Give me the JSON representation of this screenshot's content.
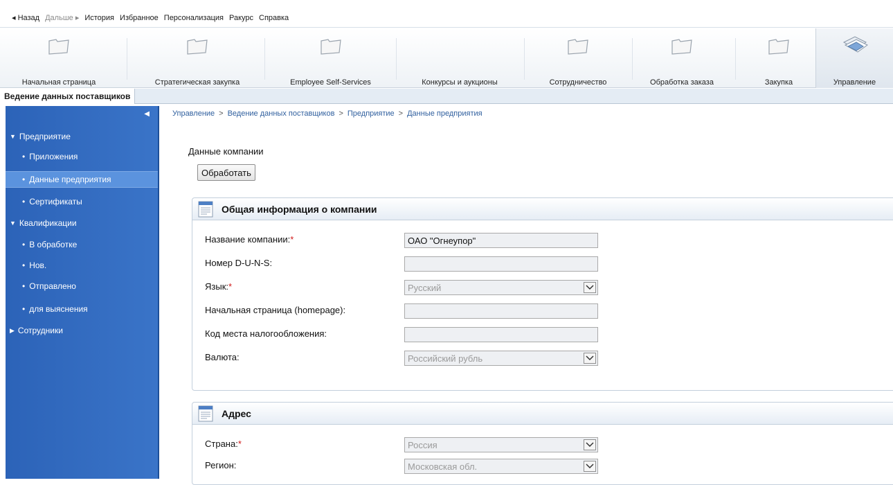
{
  "topmenu": {
    "back": "◂ Назад",
    "forward": "Дальше ▸",
    "history": "История",
    "favorites": "Избранное",
    "personalize": "Персонализация",
    "view": "Ракурс",
    "help": "Справка"
  },
  "navtabs": [
    {
      "label": "Начальная страница",
      "icon": "folder-icon"
    },
    {
      "label": "Стратегическая закупка",
      "icon": "folder-icon"
    },
    {
      "label": "Employee Self-Services",
      "icon": "folder-icon"
    },
    {
      "label": "Конкурсы и аукционы"
    },
    {
      "label": "Сотрудничество",
      "icon": "folder-icon"
    },
    {
      "label": "Обработка заказа",
      "icon": "folder-icon"
    },
    {
      "label": "Закупка",
      "icon": "folder-icon"
    },
    {
      "label": "Управление",
      "icon": "documents-icon"
    }
  ],
  "subbar": {
    "tab": "Ведение данных поставщиков"
  },
  "sidebar": {
    "items": [
      {
        "label": "Предприятие"
      },
      {
        "label": "Приложения"
      },
      {
        "label": "Данные предприятия"
      },
      {
        "label": "Сертификаты"
      },
      {
        "label": "Квалификации"
      },
      {
        "label": "В обработке"
      },
      {
        "label": "Нов."
      },
      {
        "label": "Отправлено"
      },
      {
        "label": "для выяснения"
      },
      {
        "label": "Сотрудники"
      }
    ]
  },
  "breadcrumb": [
    "Управление",
    "Ведение данных поставщиков",
    "Предприятие",
    "Данные предприятия"
  ],
  "page": {
    "title": "Данные компании",
    "edit_button": "Обработать"
  },
  "general": {
    "title": "Общая информация о компании",
    "fields": [
      {
        "label": "Название компании:",
        "required": "*",
        "value": "ОАО \"Огнеупор\""
      },
      {
        "label": "Номер D-U-N-S:",
        "value": ""
      },
      {
        "label": "Язык:",
        "required": "*",
        "value": "Русский"
      },
      {
        "label": "Начальная страница (homepage):",
        "value": ""
      },
      {
        "label": "Код места налогообложения:",
        "value": ""
      },
      {
        "label": "Валюта:",
        "value": "Российский рубль"
      }
    ]
  },
  "address": {
    "title": "Адрес",
    "fields": [
      {
        "label": "Страна:",
        "required": "*",
        "value": "Россия"
      },
      {
        "label": "Регион:",
        "value": "Московская обл."
      }
    ]
  },
  "colors": {
    "sidebar": "#3a74c8",
    "sidebar_selected": "#5b93de",
    "required": "#d01919"
  }
}
